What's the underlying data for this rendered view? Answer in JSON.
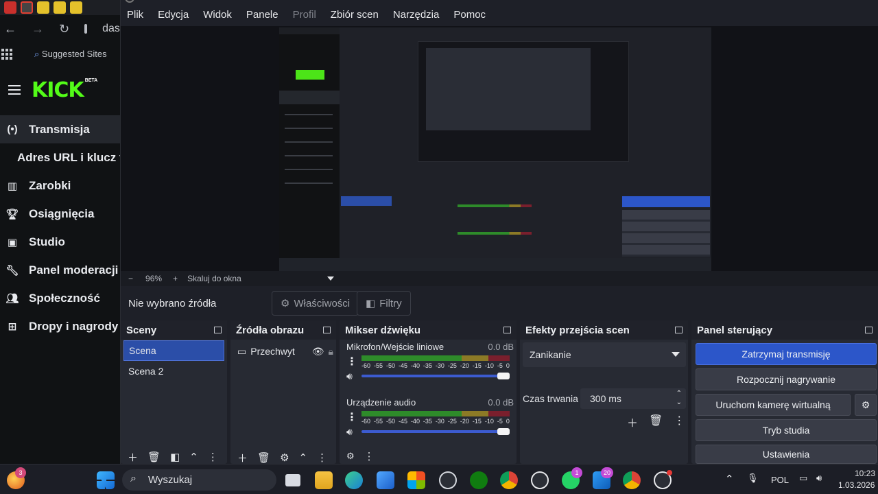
{
  "browser": {
    "url_text": "dash",
    "bookmark": "Suggested Sites",
    "kick_logo": "KICK",
    "kick_beta": "BETA",
    "menu": [
      {
        "label": "Transmisja",
        "icon": "broadcast-icon"
      },
      {
        "label": "Adres URL i klucz tr",
        "icon": ""
      },
      {
        "label": "Zarobki",
        "icon": "chart-icon"
      },
      {
        "label": "Osiągnięcia",
        "icon": "trophy-icon"
      },
      {
        "label": "Studio",
        "icon": "studio-icon"
      },
      {
        "label": "Panel moderacji",
        "icon": "wrench-icon"
      },
      {
        "label": "Społeczność",
        "icon": "people-icon"
      },
      {
        "label": "Dropy i nagrody",
        "icon": "gift-icon"
      }
    ]
  },
  "obs": {
    "menu": [
      "Plik",
      "Edycja",
      "Widok",
      "Panele",
      "Profil",
      "Zbiór scen",
      "Narzędzia",
      "Pomoc"
    ],
    "zoom": {
      "minus": "−",
      "value": "96%",
      "plus": "+",
      "fit": "Skaluj do okna"
    },
    "source_bar": {
      "label": "Nie wybrano źródła",
      "properties": "Właściwości",
      "filters": "Filtry"
    },
    "scenes": {
      "title": "Sceny",
      "items": [
        "Scena",
        "Scena 2"
      ]
    },
    "sources": {
      "title": "Źródła obrazu",
      "items": [
        "Przechwyt"
      ]
    },
    "mixer": {
      "title": "Mikser dźwięku",
      "tracks": [
        {
          "name": "Mikrofon/Wejście liniowe",
          "db": "0.0 dB"
        },
        {
          "name": "Urządzenie audio",
          "db": "0.0 dB"
        }
      ],
      "scale": [
        "-60",
        "-55",
        "-50",
        "-45",
        "-40",
        "-35",
        "-30",
        "-25",
        "-20",
        "-15",
        "-10",
        "-5",
        "0"
      ]
    },
    "transitions": {
      "title": "Efekty przejścia scen",
      "type": "Zanikanie",
      "duration_label": "Czas trwania",
      "duration": "300 ms"
    },
    "controls": {
      "title": "Panel sterujący",
      "buttons": [
        "Zatrzymaj transmisję",
        "Rozpocznij nagrywanie",
        "Uruchom kamerę wirtualną",
        "Tryb studia",
        "Ustawienia"
      ]
    }
  },
  "taskbar": {
    "search": "Wyszukaj",
    "lang": "POL",
    "time": "10:23",
    "date": "1.03.2026",
    "badges": {
      "edge_notif": "3",
      "whatsapp": "1",
      "tasks": "20"
    }
  },
  "colors": {
    "accent_blue": "#2c56c9",
    "kick_green": "#53fc18",
    "meter_green": "#2e8b2a",
    "meter_yellow": "#8c7a26",
    "meter_red": "#7a1f2d"
  }
}
